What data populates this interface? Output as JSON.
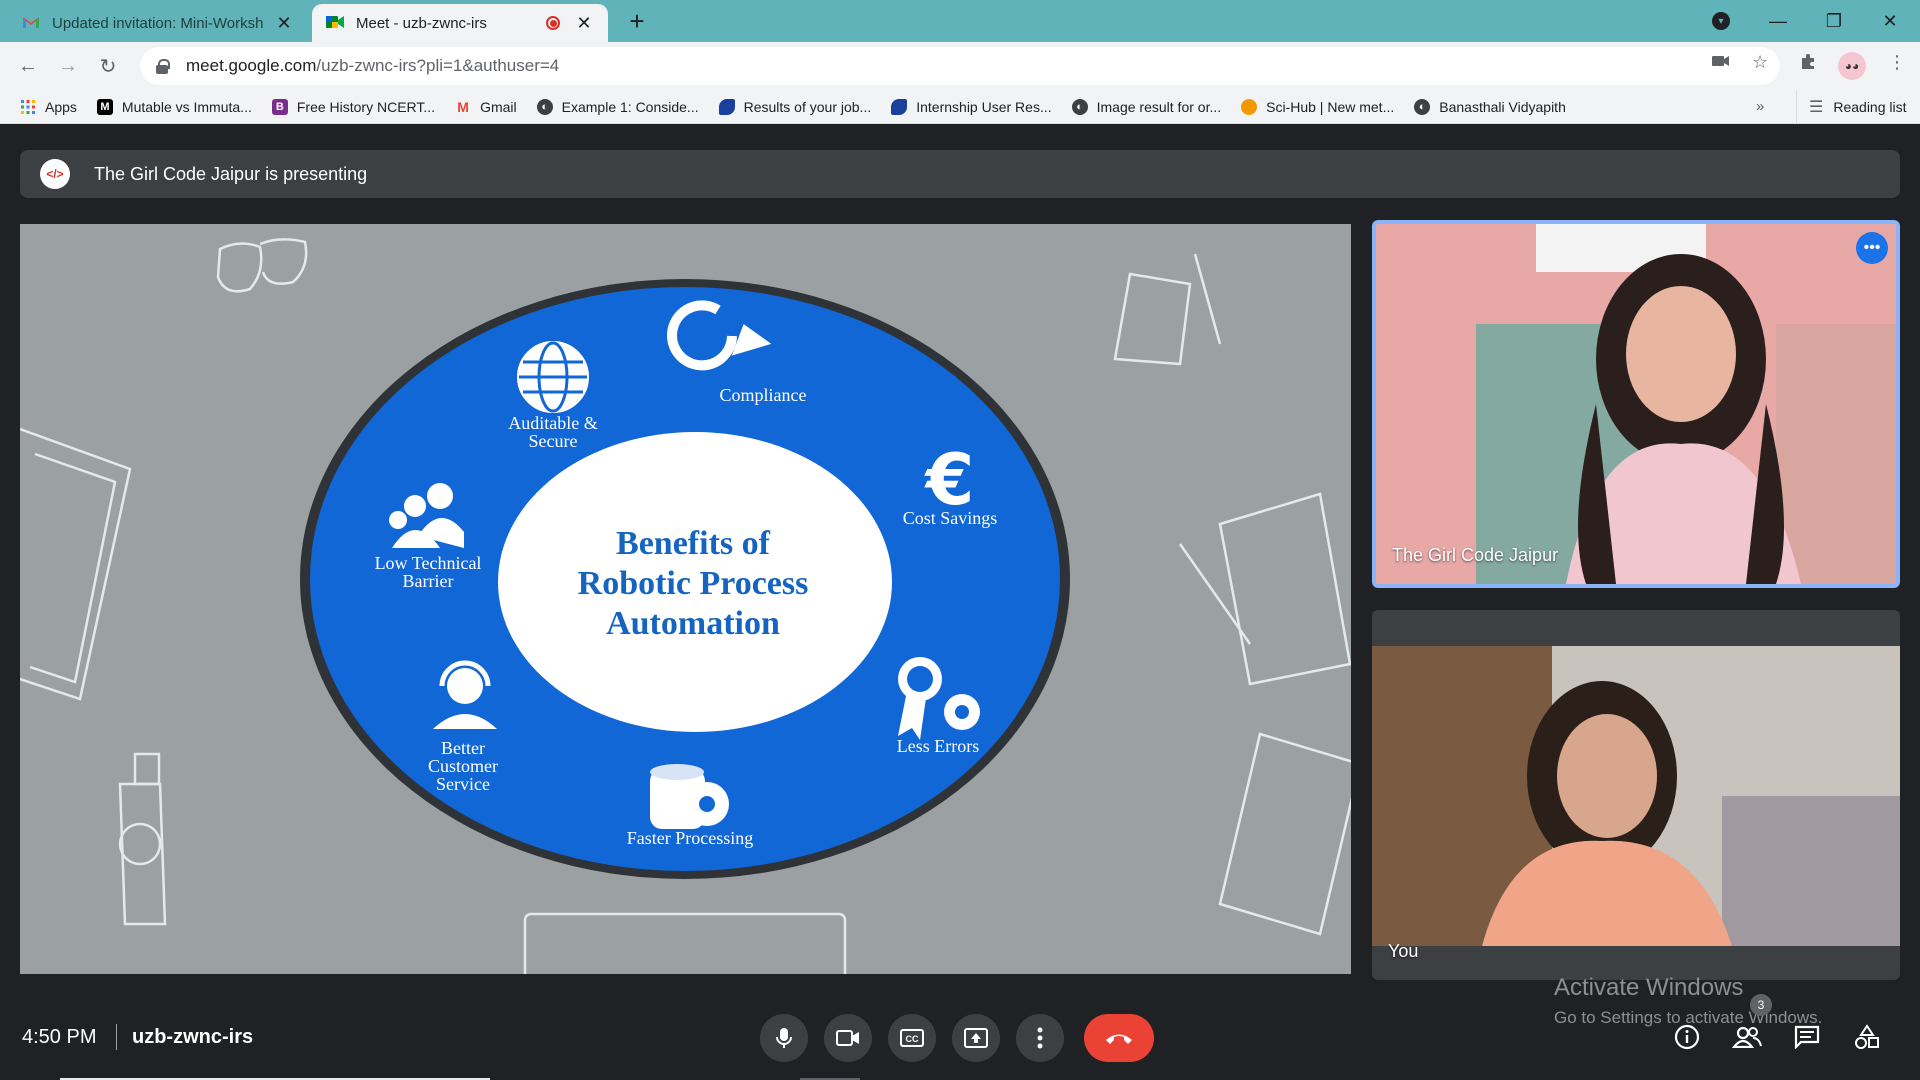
{
  "browser": {
    "tabs": [
      {
        "title": "Updated invitation: Mini-Worksh",
        "active": false,
        "icon": "gmail-icon"
      },
      {
        "title": "Meet - uzb-zwnc-irs",
        "active": true,
        "icon": "meet-icon",
        "recording": true
      }
    ],
    "new_tab": "+",
    "url_host": "meet.google.com",
    "url_path": "/uzb-zwnc-irs?pli=1&authuser=4",
    "bookmarks": [
      {
        "label": "Apps",
        "icon": "apps-grid-icon"
      },
      {
        "label": "Mutable vs Immuta...",
        "icon": "medium-icon"
      },
      {
        "label": "Free History NCERT...",
        "icon": "bookmark-b-icon"
      },
      {
        "label": "Gmail",
        "icon": "gmail-icon"
      },
      {
        "label": "Example 1: Conside...",
        "icon": "globe-icon"
      },
      {
        "label": "Results of your job...",
        "icon": "feather-icon"
      },
      {
        "label": "Internship User Res...",
        "icon": "feather-icon"
      },
      {
        "label": "Image result for or...",
        "icon": "globe-icon"
      },
      {
        "label": "Sci-Hub | New met...",
        "icon": "scihub-icon"
      },
      {
        "label": "Banasthali Vidyapith",
        "icon": "globe-icon"
      }
    ],
    "more_bookmarks": "»",
    "reading_list": "Reading list"
  },
  "meet": {
    "presenting_banner": "The Girl Code Jaipur is presenting",
    "slide": {
      "center_title": [
        "Benefits of",
        "Robotic Process",
        "Automation"
      ],
      "items": [
        {
          "label": [
            "Compliance"
          ],
          "icon": "refresh-arrows-icon"
        },
        {
          "label": [
            "Cost Savings"
          ],
          "icon": "euro-icon"
        },
        {
          "label": [
            "Less Errors"
          ],
          "icon": "award-gear-icon"
        },
        {
          "label": [
            "Faster Processing"
          ],
          "icon": "database-gear-icon"
        },
        {
          "label": [
            "Better",
            "Customer",
            "Service"
          ],
          "icon": "headset-user-icon"
        },
        {
          "label": [
            "Low Technical",
            "Barrier"
          ],
          "icon": "users-group-icon"
        },
        {
          "label": [
            "Auditable &",
            "Secure"
          ],
          "icon": "globe-icon"
        }
      ]
    },
    "participants": [
      {
        "name": "The Girl Code Jaipur"
      },
      {
        "name": "You"
      }
    ],
    "time": "4:50 PM",
    "meeting_code": "uzb-zwnc-irs",
    "participants_count": "3",
    "watermark": {
      "line1": "Activate Windows",
      "line2": "Go to Settings to activate Windows."
    },
    "colors": {
      "slide_blue": "#1167d6",
      "end_call": "#ea4335",
      "meet_bg": "#202124"
    }
  }
}
